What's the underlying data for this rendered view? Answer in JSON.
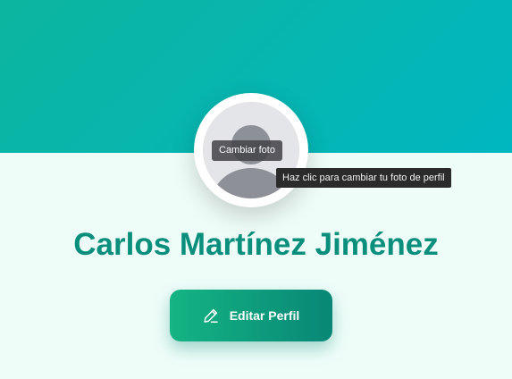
{
  "profile": {
    "name": "Carlos Martínez Jiménez",
    "change_photo_label": "Cambiar foto",
    "change_photo_tooltip": "Haz clic para cambiar tu foto de perfil",
    "edit_button_label": "Editar Perfil",
    "avatar_icon": "user-placeholder-icon",
    "edit_icon": "pencil-icon"
  },
  "colors": {
    "hero_start": "#0cb59f",
    "hero_end": "#00b6c0",
    "page_background": "#effdf9",
    "name_text": "#0a8f7d",
    "button_start": "#14b483",
    "button_end": "#088776"
  }
}
